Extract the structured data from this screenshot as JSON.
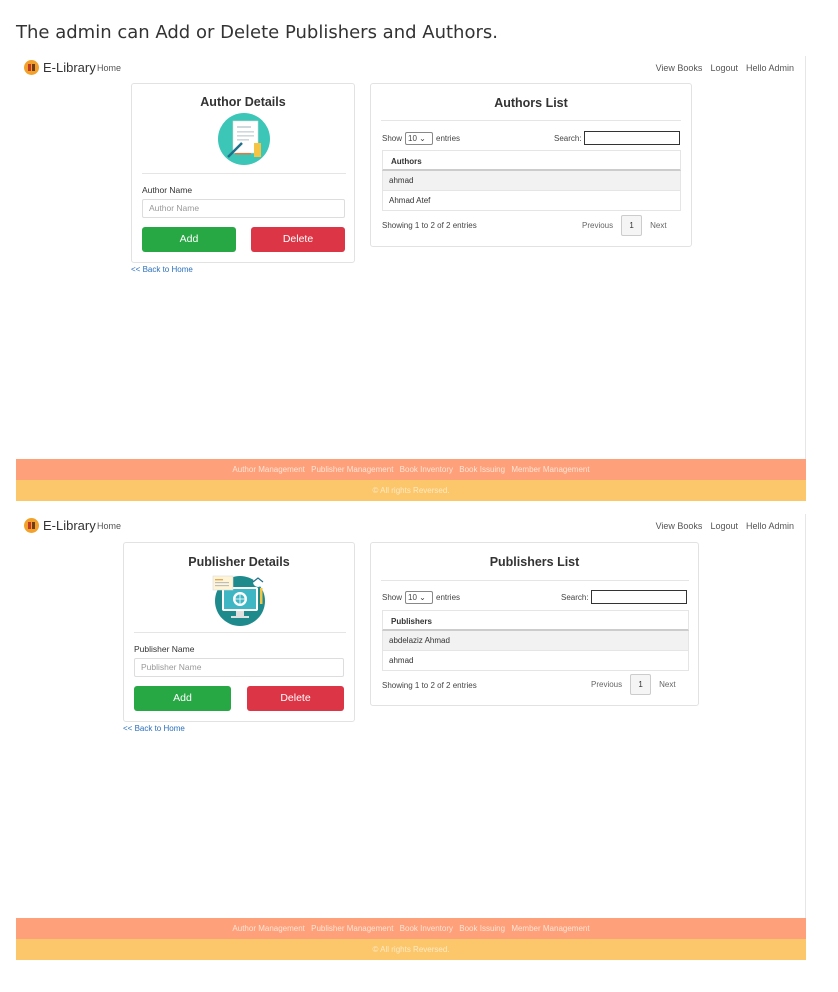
{
  "caption": "The admin can Add or Delete Publishers and Authors.",
  "navbar": {
    "brand": "E-Library",
    "home": "Home",
    "right": [
      "View Books",
      "Logout",
      "Hello Admin"
    ]
  },
  "author_panel": {
    "title": "Author Details",
    "field_label": "Author Name",
    "field_placeholder": "Author Name",
    "add_label": "Add",
    "delete_label": "Delete",
    "back_link": "<< Back to Home"
  },
  "authors_list": {
    "title": "Authors List",
    "show": "Show",
    "entries_value": "10",
    "entries": "entries",
    "search": "Search:",
    "column": "Authors",
    "rows": [
      "ahmad",
      "Ahmad Atef"
    ],
    "info": "Showing 1 to 2 of 2 entries",
    "previous": "Previous",
    "page": "1",
    "next": "Next"
  },
  "publisher_panel": {
    "title": "Publisher Details",
    "field_label": "Publisher Name",
    "field_placeholder": "Publisher Name",
    "add_label": "Add",
    "delete_label": "Delete",
    "back_link": "<< Back to Home"
  },
  "publishers_list": {
    "title": "Publishers List",
    "show": "Show",
    "entries_value": "10",
    "entries": "entries",
    "search": "Search:",
    "column": "Publishers",
    "rows": [
      "abdelaziz Ahmad",
      "ahmad"
    ],
    "info": "Showing 1 to 2 of 2 entries",
    "previous": "Previous",
    "page": "1",
    "next": "Next"
  },
  "footer": {
    "links": [
      "Author Management",
      "Publisher Management",
      "Book Inventory",
      "Book Issuing",
      "Member Management"
    ],
    "copyright": "© All rights Reversed."
  },
  "colors": {
    "add": "#28a745",
    "delete": "#dc3545",
    "footer_top": "#fea07a",
    "footer_bottom": "#fcc66b",
    "link": "#2a6fbd"
  },
  "icons": {
    "brand": "book-logo-icon",
    "author": "author-document-icon",
    "publisher": "publisher-monitor-icon"
  }
}
